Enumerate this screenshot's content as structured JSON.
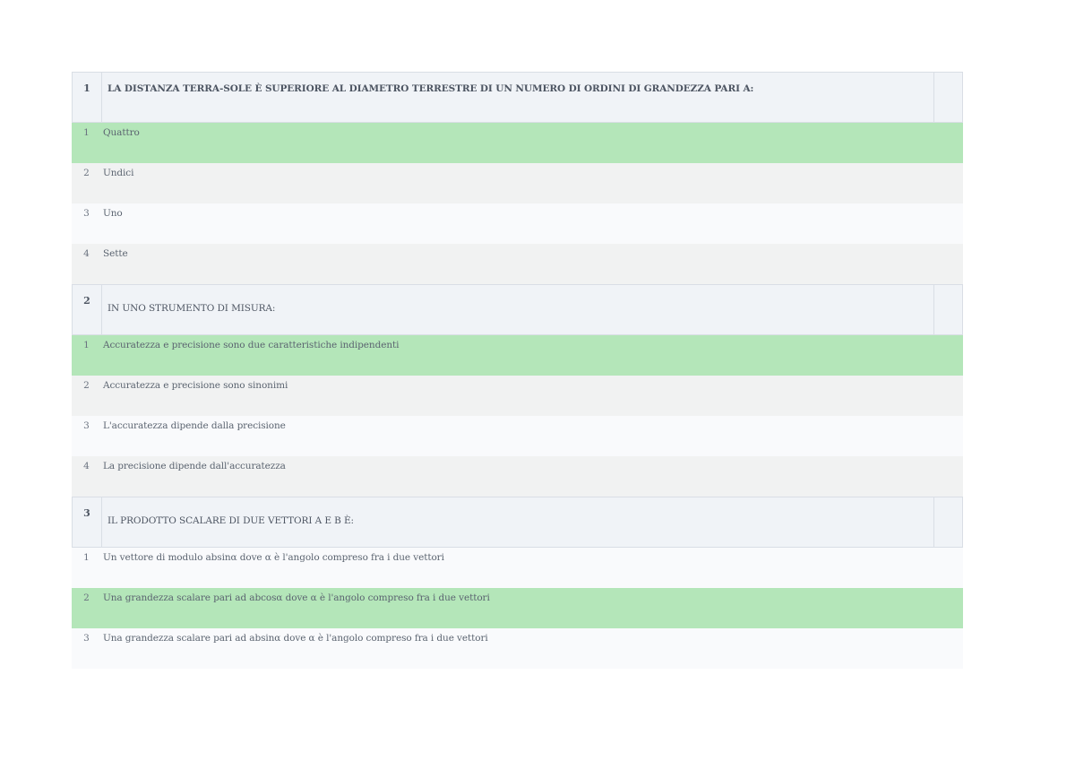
{
  "questions": [
    {
      "number": "1",
      "text": "LA DISTANZA TERRA-SOLE È SUPERIORE AL DIAMETRO TERRESTRE DI UN NUMERO DI ORDINI DI GRANDEZZA PARI A:",
      "answers": [
        {
          "number": "1",
          "text": "Quattro",
          "correct": true
        },
        {
          "number": "2",
          "text": "Undici",
          "correct": false
        },
        {
          "number": "3",
          "text": "Uno",
          "correct": false
        },
        {
          "number": "4",
          "text": "Sette",
          "correct": false
        }
      ]
    },
    {
      "number": "2",
      "text": "IN UNO STRUMENTO DI MISURA:",
      "answers": [
        {
          "number": "1",
          "text": "Accuratezza e precisione sono due caratteristiche indipendenti",
          "correct": true
        },
        {
          "number": "2",
          "text": "Accuratezza e precisione sono sinonimi",
          "correct": false
        },
        {
          "number": "3",
          "text": "L'accuratezza dipende dalla precisione",
          "correct": false
        },
        {
          "number": "4",
          "text": "La precisione dipende dall'accuratezza",
          "correct": false
        }
      ]
    },
    {
      "number": "3",
      "text": "IL PRODOTTO SCALARE DI DUE VETTORI A E B È:",
      "answers": [
        {
          "number": "1",
          "text": "Un vettore di modulo absinα dove α è l'angolo compreso fra i due vettori",
          "correct": false
        },
        {
          "number": "2",
          "text": "Una grandezza scalare pari ad abcosα dove α è l'angolo compreso fra i due vettori",
          "correct": true
        },
        {
          "number": "3",
          "text": "Una grandezza scalare pari ad absinα dove α è l'angolo compreso fra i due vettori",
          "correct": false
        }
      ]
    }
  ],
  "colors": {
    "correct_bg": "#b4e6b9",
    "header_bg": "#f0f3f7",
    "row_alt_a": "#f1f2f2",
    "row_alt_b": "#f9fafc"
  }
}
